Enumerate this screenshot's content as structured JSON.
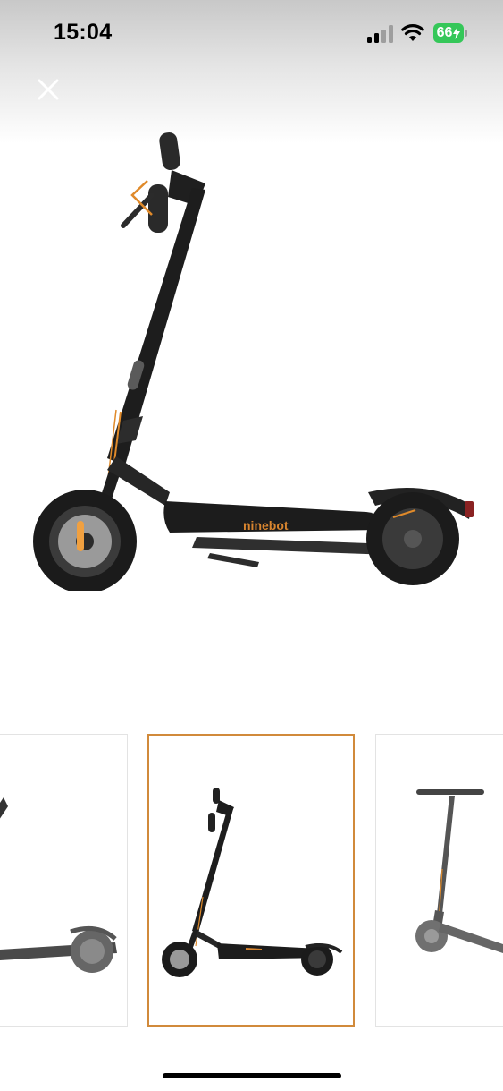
{
  "status_bar": {
    "time": "15:04",
    "battery": "66",
    "battery_color": "#35c759"
  },
  "viewer": {
    "close_icon": "close-icon",
    "main_image": {
      "description_icon": "scooter-side-view-image",
      "deck_brand": "ninebot"
    },
    "thumbnails": [
      {
        "icon": "scooter-rear-angle-image",
        "selected": false
      },
      {
        "icon": "scooter-side-view-image",
        "selected": true
      },
      {
        "icon": "scooter-front-angle-image",
        "selected": false
      }
    ],
    "accent_color": "#d18a3b"
  }
}
